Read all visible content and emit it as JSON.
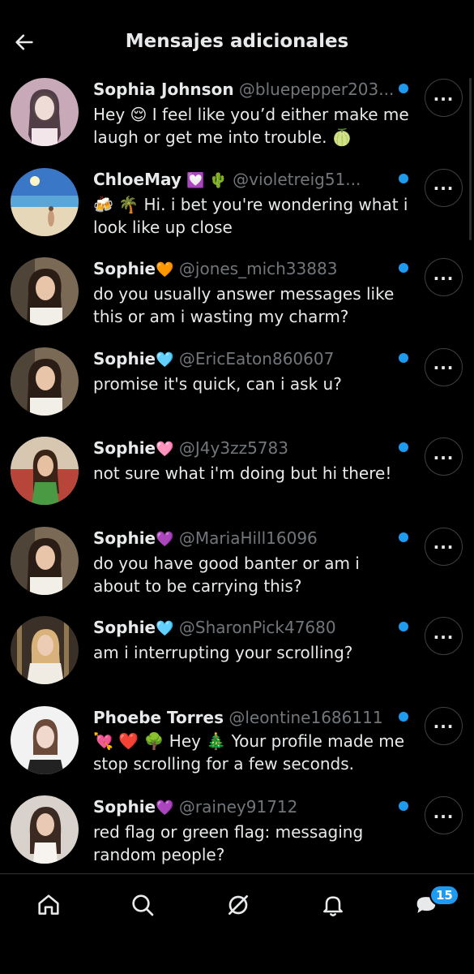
{
  "header": {
    "title": "Mensajes adicionales"
  },
  "colors": {
    "accent": "#1d9bf0",
    "background": "#000000",
    "muted": "#71767b"
  },
  "messages": [
    {
      "name": "Sophia Johnson",
      "emoji": "",
      "handle": "@bluepepper203...",
      "text": "Hey 😌 I feel like you’d either make me laugh or get me into trouble. 🍈",
      "unread": true
    },
    {
      "name": "ChloeMay",
      "emoji": "💟 🌵",
      "handle": "@violetreig51...",
      "text": "🍻 🌴 Hi. i bet you're wondering what i look like up close",
      "unread": true
    },
    {
      "name": "Sophie",
      "emoji": "🧡",
      "handle": "@jones_mich33883",
      "text": "do you usually answer messages like this or am i wasting my charm?",
      "unread": true
    },
    {
      "name": "Sophie",
      "emoji": "🩵",
      "handle": "@EricEaton860607",
      "text": "promise it's quick, can i ask u?",
      "unread": true
    },
    {
      "name": "Sophie",
      "emoji": "🩷",
      "handle": "@J4y3zz5783",
      "text": "not sure what i'm doing but hi there!",
      "unread": true
    },
    {
      "name": "Sophie",
      "emoji": "💜",
      "handle": "@MariaHill16096",
      "text": "do you have good banter or am i about to be carrying this?",
      "unread": true
    },
    {
      "name": "Sophie",
      "emoji": "🩵",
      "handle": "@SharonPick47680",
      "text": "am i interrupting your scrolling?",
      "unread": true
    },
    {
      "name": "Phoebe Torres",
      "emoji": "",
      "handle": "@leontine1686111",
      "text": "💘 ❤️ 🌳 Hey 🎄 Your profile made me stop scrolling for a few seconds.",
      "unread": true
    },
    {
      "name": "Sophie",
      "emoji": "💜",
      "handle": "@rainey91712",
      "text": "red flag or green flag: messaging random people?",
      "unread": true
    }
  ],
  "tabbar": {
    "messages_badge": "15"
  }
}
